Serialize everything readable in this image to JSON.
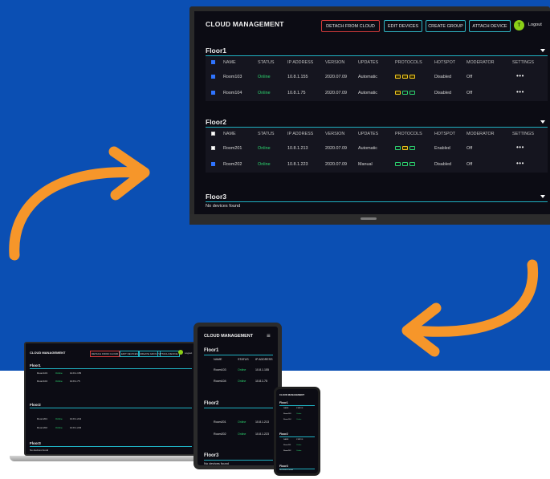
{
  "app": {
    "title": "CLOUD MANAGEMENT",
    "buttons": {
      "detach": "DETACH FROM CLOUD",
      "edit": "EDIT DEVICES",
      "create": "CREATE GROUP",
      "attach": "ATTACH DEVICE"
    },
    "avatar_initial": "T",
    "logout": "Logout"
  },
  "columns": [
    "NAME",
    "STATUS",
    "IP ADDRESS",
    "VERSION",
    "UPDATES",
    "PROTOCOLS",
    "HOTSPOT",
    "MODERATOR",
    "SETTINGS"
  ],
  "floors": [
    {
      "title": "Floor1",
      "rows": [
        {
          "name": "Room103",
          "status": "Online",
          "ip": "10.8.1.155",
          "version": "2020.07.09",
          "updates": "Automatic",
          "hotspot": "Disabled",
          "moderator": "Off",
          "settings": "•••"
        },
        {
          "name": "Room104",
          "status": "Online",
          "ip": "10.8.1.75",
          "version": "2020.07.09",
          "updates": "Automatic",
          "hotspot": "Disabled",
          "moderator": "Off",
          "settings": "•••"
        }
      ]
    },
    {
      "title": "Floor2",
      "rows": [
        {
          "name": "Room201",
          "status": "Online",
          "ip": "10.8.1.213",
          "version": "2020.07.09",
          "updates": "Automatic",
          "hotspot": "Enabled",
          "moderator": "Off",
          "settings": "•••"
        },
        {
          "name": "Room202",
          "status": "Online",
          "ip": "10.8.1.223",
          "version": "2020.07.09",
          "updates": "Manual",
          "hotspot": "Disabled",
          "moderator": "Off",
          "settings": "•••"
        }
      ]
    },
    {
      "title": "Floor3",
      "empty": "No devices found"
    }
  ],
  "colors": {
    "background_blue": "#0b4fb3",
    "arrow_orange": "#f6962a",
    "accent_cyan": "#1fb1c2",
    "online_green": "#2cd56f",
    "detach_red": "#d23a3a"
  }
}
